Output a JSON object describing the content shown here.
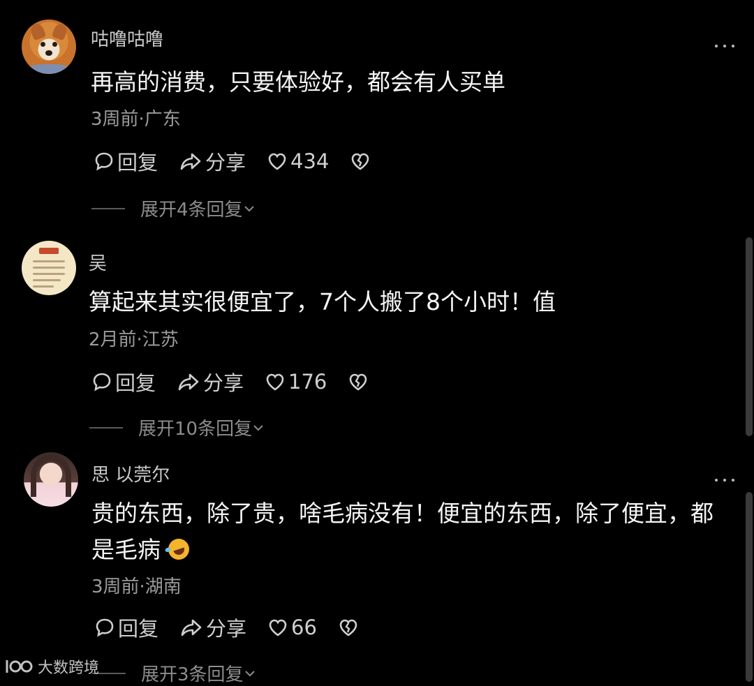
{
  "comments": [
    {
      "username": "咕噜咕噜",
      "text_lines": [
        "再高的消费，只要体验好，都会有人买单"
      ],
      "meta": "3周前·广东",
      "reply_label": "回复",
      "share_label": "分享",
      "likes": "434",
      "expand_label": "展开4条回复"
    },
    {
      "username": "吴",
      "text_lines": [
        "算起来其实很便宜了，7个人搬了8个小时！值"
      ],
      "meta": "2月前·江苏",
      "reply_label": "回复",
      "share_label": "分享",
      "likes": "176",
      "expand_label": "展开10条回复"
    },
    {
      "username": "思 以莞尔",
      "text_lines": [
        "贵的东西，除了贵，啥毛病没有！便宜的东西，除了便宜，都",
        "是毛病"
      ],
      "meta": "3周前·湖南",
      "reply_label": "回复",
      "share_label": "分享",
      "likes": "66",
      "expand_label": "展开3条回复"
    }
  ],
  "watermark": "大数跨境",
  "icons": {
    "reply": "comment-bubble-icon",
    "share": "share-arrow-icon",
    "like": "heart-icon",
    "dislike": "broken-heart-icon",
    "more": "more-dots-icon",
    "expand": "chevron-down-icon"
  }
}
